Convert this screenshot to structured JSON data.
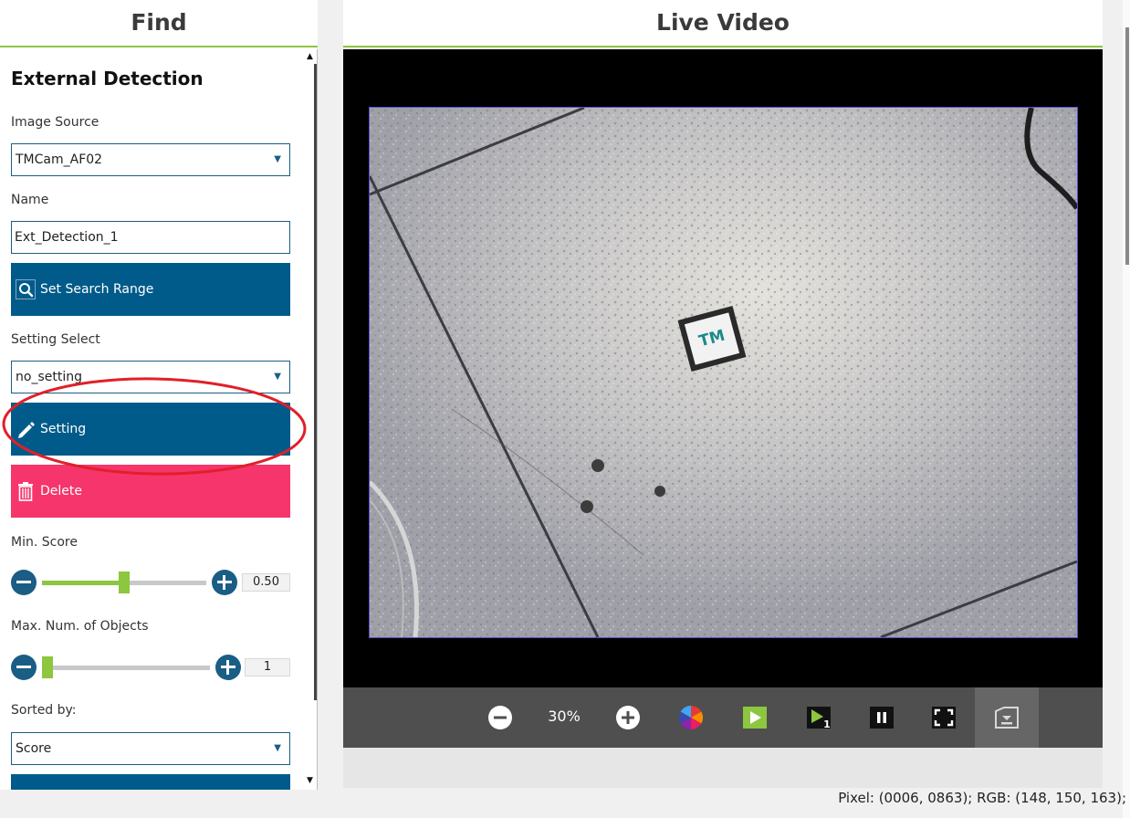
{
  "left_panel": {
    "title": "Find",
    "section_title": "External Detection",
    "image_source": {
      "label": "Image Source",
      "value": "TMCam_AF02"
    },
    "name": {
      "label": "Name",
      "value": "Ext_Detection_1"
    },
    "set_search_range_label": "Set Search Range",
    "setting_select": {
      "label": "Setting Select",
      "value": "no_setting"
    },
    "setting_label": "Setting",
    "delete_label": "Delete",
    "min_score": {
      "label": "Min. Score",
      "value": "0.50",
      "level": 0.5
    },
    "max_objects": {
      "label": "Max. Num. of Objects",
      "value": "1",
      "level": 0.0
    },
    "sorted_by": {
      "label": "Sorted by:",
      "value": "Score"
    }
  },
  "live_video": {
    "title": "Live Video",
    "zoom": "30%",
    "marker_text": "TM"
  },
  "status_bar": "Pixel: (0006, 0863); RGB: (148, 150, 163);",
  "colors": {
    "accent_green": "#8dc63f",
    "primary_blue": "#005b8a",
    "danger_pink": "#f5356b",
    "highlight_red": "#e0202a"
  },
  "icons": [
    "search-icon",
    "pencil-icon",
    "trash-icon",
    "minus-icon",
    "plus-icon",
    "color-wheel-icon",
    "play-icon",
    "play-once-icon",
    "pause-icon",
    "fit-screen-icon",
    "save-image-icon"
  ]
}
